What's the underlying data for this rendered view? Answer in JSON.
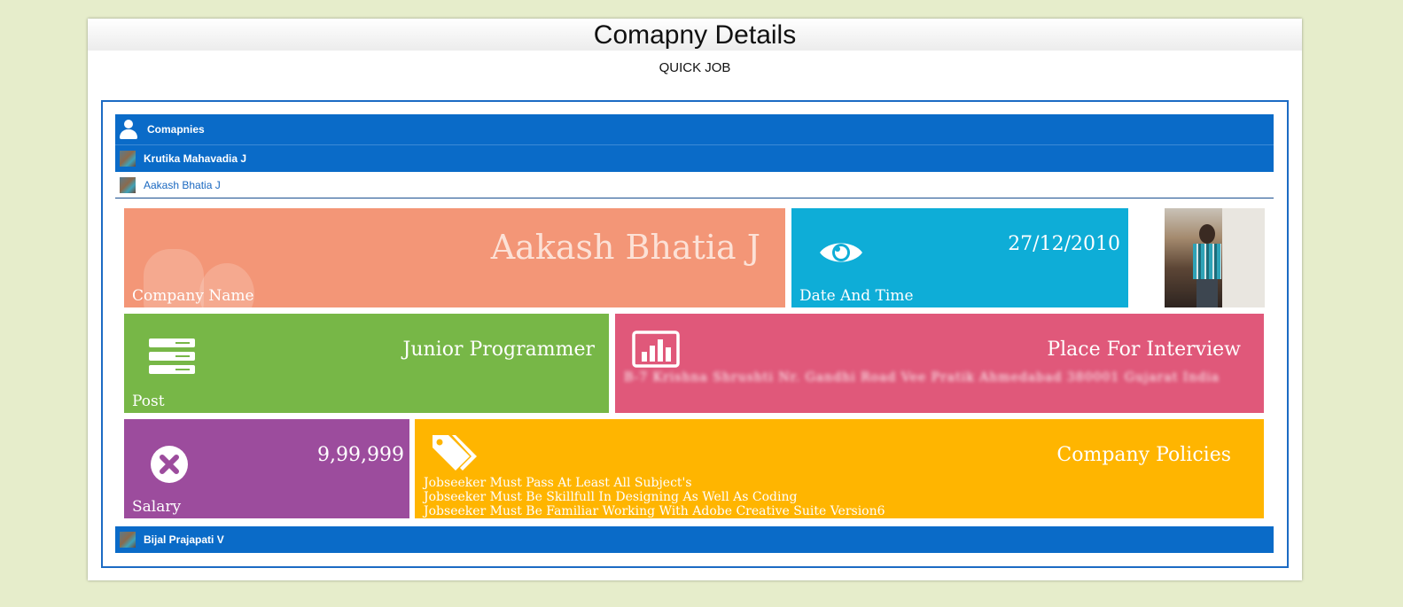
{
  "panel": {
    "title": "Comapny Details",
    "subtitle": "QUICK JOB"
  },
  "list": {
    "header_label": "Comapnies",
    "items": [
      {
        "name": "Krutika Mahavadia J"
      },
      {
        "name": "Aakash Bhatia J"
      },
      {
        "name": "Bijal Prajapati V"
      }
    ]
  },
  "details": {
    "company": {
      "value": "Aakash Bhatia J",
      "label": "Company Name"
    },
    "date": {
      "value": "27/12/2010",
      "label": "Date And Time"
    },
    "post": {
      "value": "Junior Programmer",
      "label": "Post"
    },
    "place": {
      "title": "Place For Interview",
      "address": "B-7 Krishna Shrushti Nr. Gandhi Road Vee Pratik Ahmedabad 380001 Gujarat India"
    },
    "salary": {
      "value": "9,99,999",
      "label": "Salary"
    },
    "policies": {
      "title": "Company Policies",
      "lines": [
        "Jobseeker Must Pass At Least All Subject's",
        "Jobseeker Must Be Skillfull In Designing As Well As Coding",
        "Jobseeker Must Be Familiar Working With Adobe Creative Suite Version6"
      ]
    }
  },
  "colors": {
    "background": "#e6edcb",
    "accent_blue": "#0a6bc8",
    "company_tile": "#f39677",
    "date_tile": "#0eadd7",
    "post_tile": "#77b747",
    "place_tile": "#e0587a",
    "salary_tile": "#9c4c9d",
    "policy_tile": "#ffb500"
  },
  "icons": [
    "user-icon",
    "eye-icon",
    "server-icon",
    "bar-chart-icon",
    "close-circle-icon",
    "tags-icon"
  ]
}
